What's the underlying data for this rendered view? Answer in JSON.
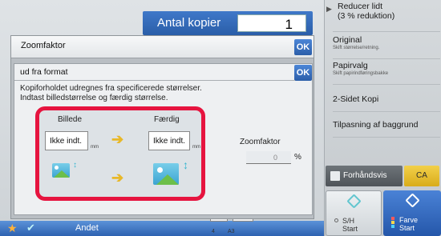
{
  "copies": {
    "label": "Antal kopier",
    "value": "1"
  },
  "right_panel": {
    "items": [
      {
        "title": "Reducer lidt\n(3 % reduktion)",
        "sub": ""
      },
      {
        "title": "Original",
        "sub": "Skift størrelse/retning."
      },
      {
        "title": "Papirvalg",
        "sub": "Skift papirindføringsbakke"
      },
      {
        "title": "2-Sidet Kopi",
        "sub": ""
      },
      {
        "title": "Tilpasning af baggrund",
        "sub": ""
      }
    ],
    "preview_label": "Forhåndsvis",
    "ca_label": "CA",
    "start_bw_label": "S/H\nStart",
    "start_color_label": "Farve\nStart"
  },
  "outer_dialog": {
    "title": "Zoomfaktor",
    "ok_label": "OK"
  },
  "inner_dialog": {
    "title": "ud fra format",
    "ok_label": "OK",
    "description": "Kopiforholdet udregnes fra specificerede størrelser.\nIndtast billedstørrelse og færdig størrelse.",
    "original_header": "Billede",
    "finished_header": "Færdig",
    "original_value": "Ikke indt.",
    "finished_value": "Ikke indt.",
    "unit": "mm",
    "zoom_label": "Zoomfaktor",
    "zoom_value": "0",
    "zoom_unit": "%"
  },
  "bottom_bar": {
    "other_label": "Andet",
    "paper_labels": [
      "4",
      "A3"
    ]
  },
  "icons": [
    "star-icon",
    "checkmark-icon",
    "arrow-right-icon",
    "image-icon",
    "vertical-arrow-icon",
    "start-diamond-icon",
    "preview-icon",
    "chevron-right-icon"
  ],
  "colors": {
    "accent_blue": "#2b5ea9",
    "highlight_red": "#e6143f",
    "ca_yellow": "#d9ac1a"
  }
}
